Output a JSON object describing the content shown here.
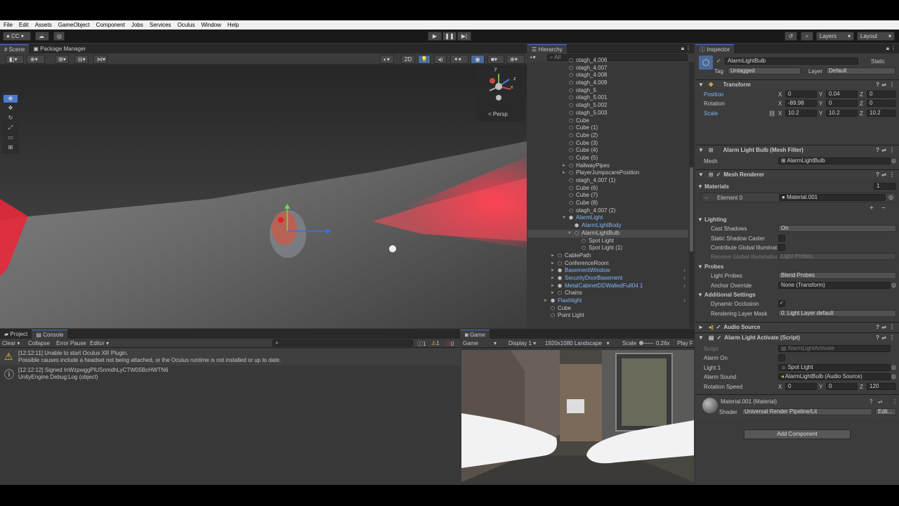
{
  "menu": [
    "File",
    "Edit",
    "Assets",
    "GameObject",
    "Component",
    "Jobs",
    "Services",
    "Oculus",
    "Window",
    "Help"
  ],
  "toolbar": {
    "account": "CC",
    "layers": "Layers",
    "layout": "Layout"
  },
  "scene_tabs": {
    "scene": "Scene",
    "package_manager": "Package Manager"
  },
  "scene": {
    "mode_2d": "2D",
    "persp": "< Persp",
    "gizmo_y": "y",
    "gizmo_x": "x",
    "gizmo_z": "z"
  },
  "hierarchy": {
    "tab": "Hierarchy",
    "search_placeholder": "All",
    "items": [
      {
        "label": "otagh_4.006",
        "indent": 0,
        "blue": false,
        "arrow": ""
      },
      {
        "label": "otagh_4.007",
        "indent": 0,
        "blue": false,
        "arrow": ""
      },
      {
        "label": "otagh_4.008",
        "indent": 0,
        "blue": false,
        "arrow": ""
      },
      {
        "label": "otagh_4.009",
        "indent": 0,
        "blue": false,
        "arrow": ""
      },
      {
        "label": "otagh_5",
        "indent": 0,
        "blue": false,
        "arrow": ""
      },
      {
        "label": "otagh_5.001",
        "indent": 0,
        "blue": false,
        "arrow": ""
      },
      {
        "label": "otagh_5.002",
        "indent": 0,
        "blue": false,
        "arrow": ""
      },
      {
        "label": "otagh_5.003",
        "indent": 0,
        "blue": false,
        "arrow": ""
      },
      {
        "label": "Cube",
        "indent": 0,
        "blue": false,
        "arrow": ""
      },
      {
        "label": "Cube (1)",
        "indent": 0,
        "blue": false,
        "arrow": ""
      },
      {
        "label": "Cube (2)",
        "indent": 0,
        "blue": false,
        "arrow": ""
      },
      {
        "label": "Cube (3)",
        "indent": 0,
        "blue": false,
        "arrow": ""
      },
      {
        "label": "Cube (4)",
        "indent": 0,
        "blue": false,
        "arrow": ""
      },
      {
        "label": "Cube (5)",
        "indent": 0,
        "blue": false,
        "arrow": ""
      },
      {
        "label": "HallwayPipes",
        "indent": 0,
        "blue": false,
        "arrow": "►"
      },
      {
        "label": "PlayerJumpscarePosition",
        "indent": 0,
        "blue": false,
        "arrow": "►"
      },
      {
        "label": "otagh_4.007 (1)",
        "indent": 0,
        "blue": false,
        "arrow": ""
      },
      {
        "label": "Cube (6)",
        "indent": 0,
        "blue": false,
        "arrow": ""
      },
      {
        "label": "Cube (7)",
        "indent": 0,
        "blue": false,
        "arrow": ""
      },
      {
        "label": "Cube (8)",
        "indent": 0,
        "blue": false,
        "arrow": ""
      },
      {
        "label": "otagh_4.007 (2)",
        "indent": 0,
        "blue": false,
        "arrow": ""
      },
      {
        "label": "AlarmLight",
        "indent": 0,
        "blue": true,
        "arrow": "▼"
      },
      {
        "label": "AlarmLightBody",
        "indent": 1,
        "blue": true,
        "arrow": ""
      },
      {
        "label": "AlarmLightBulb",
        "indent": 1,
        "blue": false,
        "arrow": "▼",
        "selected": true
      },
      {
        "label": "Spot Light",
        "indent": 2,
        "blue": false,
        "arrow": ""
      },
      {
        "label": "Spot Light (1)",
        "indent": 2,
        "blue": false,
        "arrow": ""
      },
      {
        "label": "CablePath",
        "indent": -1,
        "blue": false,
        "arrow": "►"
      },
      {
        "label": "ConferenceRoom",
        "indent": -1,
        "blue": false,
        "arrow": "►"
      },
      {
        "label": "BasementWindow",
        "indent": -1,
        "blue": true,
        "arrow": "►"
      },
      {
        "label": "SecurityDoorBasement",
        "indent": -1,
        "blue": true,
        "arrow": "►"
      },
      {
        "label": "MetalCabinetDDWalledFull04 1",
        "indent": -1,
        "blue": true,
        "arrow": "►"
      },
      {
        "label": "Chains",
        "indent": -1,
        "blue": false,
        "arrow": "►"
      },
      {
        "label": "Flashlight",
        "indent": -2,
        "blue": true,
        "arrow": "►"
      },
      {
        "label": "Cube",
        "indent": -2,
        "blue": false,
        "arrow": ""
      },
      {
        "label": "Point Light",
        "indent": -2,
        "blue": false,
        "arrow": ""
      }
    ]
  },
  "inspector": {
    "tab": "Inspector",
    "object_name": "AlarmLightBulb",
    "static_label": "Static",
    "tag_label": "Tag",
    "tag_value": "Untagged",
    "layer_label": "Layer",
    "layer_value": "Default",
    "transform": {
      "title": "Transform",
      "position": {
        "label": "Position",
        "x": "0",
        "y": "0.04",
        "z": "0"
      },
      "rotation": {
        "label": "Rotation",
        "x": "-89.98",
        "y": "0",
        "z": "0"
      },
      "scale": {
        "label": "Scale",
        "x": "10.2",
        "y": "10.2",
        "z": "10.2"
      }
    },
    "mesh_filter": {
      "title": "Alarm Light Bulb (Mesh Filter)",
      "mesh_label": "Mesh",
      "mesh_value": "AlarmLightBulb"
    },
    "mesh_renderer": {
      "title": "Mesh Renderer",
      "materials_label": "Materials",
      "materials_count": "1",
      "element0_label": "Element 0",
      "element0_value": "Material.001",
      "lighting": "Lighting",
      "cast_shadows_label": "Cast Shadows",
      "cast_shadows_value": "On",
      "static_shadow_label": "Static Shadow Caster",
      "contribute_gi_label": "Contribute Global Illumination",
      "receive_gi_label": "Receive Global Illumination",
      "receive_gi_value": "Light Probes",
      "probes": "Probes",
      "light_probes_label": "Light Probes",
      "light_probes_value": "Blend Probes",
      "anchor_label": "Anchor Override",
      "anchor_value": "None (Transform)",
      "additional": "Additional Settings",
      "dyn_occ_label": "Dynamic Occlusion",
      "rlm_label": "Rendering Layer Mask",
      "rlm_value": "0: Light Layer default"
    },
    "audio_source": {
      "title": "Audio Source"
    },
    "script": {
      "title": "Alarm Light Activate (Script)",
      "script_label": "Script",
      "script_value": "AlarmLightActivate",
      "alarm_on_label": "Alarm On",
      "light1_label": "Light 1",
      "light1_value": "Spot Light",
      "alarm_sound_label": "Alarm Sound",
      "alarm_sound_value": "AlarmLightBulb (Audio Source)",
      "rotation_speed_label": "Rotation Speed",
      "rs_x": "0",
      "rs_y": "0",
      "rs_z": "120"
    },
    "material": {
      "title": "Material.001 (Material)",
      "shader_label": "Shader",
      "shader_value": "Universal Render Pipeline/Lit",
      "edit": "Edit..."
    },
    "add_component": "Add Component"
  },
  "console": {
    "tab_project": "Project",
    "tab_console": "Console",
    "clear": "Clear",
    "collapse": "Collapse",
    "error_pause": "Error Pause",
    "editor": "Editor",
    "count_info": "1",
    "count_warn": "1",
    "count_error": "0",
    "entries": [
      {
        "line1": "[12:12:11] Unable to start Oculus XR Plugin.",
        "line2": "Possible causes include a headset not being attached, or the Oculus runtime is not installed or up to date.",
        "type": "warning"
      },
      {
        "line1": "[12:12:12] Signed InWzpwggPlUSnmdhLyCTW05BcHWTN6",
        "line2": "UnityEngine.Debug:Log (object)",
        "type": "info"
      }
    ]
  },
  "game": {
    "tab": "Game",
    "game_select": "Game",
    "display": "Display 1",
    "resolution": "1920x1080 Landscape",
    "scale_label": "Scale",
    "scale_value": "0.26x",
    "play": "Play F"
  },
  "colors": {
    "accent": "#4a7bd1",
    "red": "#e03040",
    "bg": "#383838"
  }
}
